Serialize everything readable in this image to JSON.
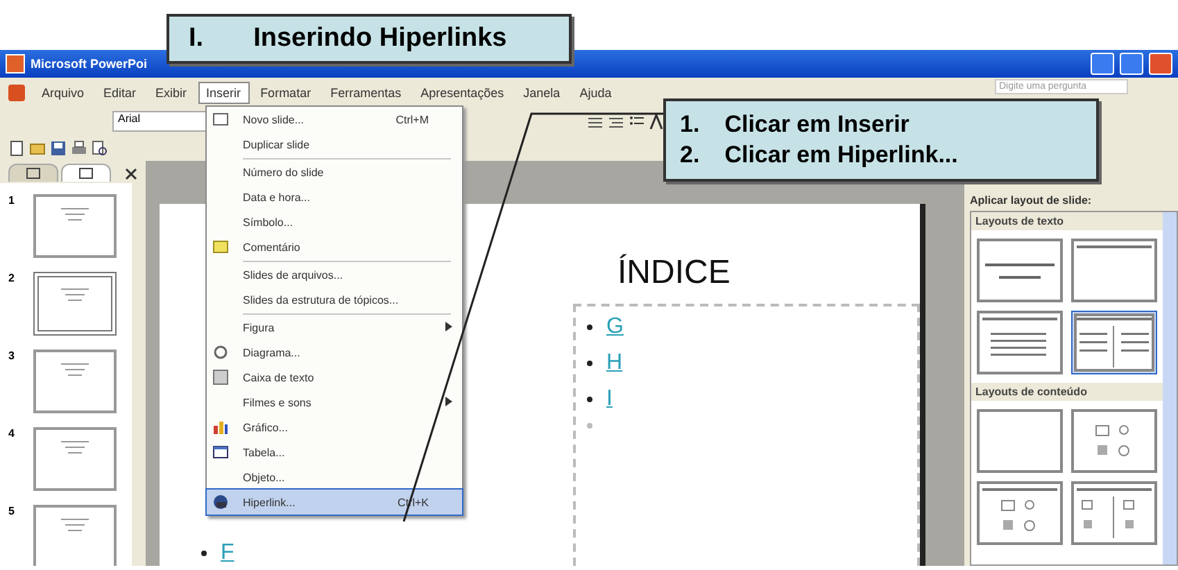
{
  "title_callout": {
    "number": "I.",
    "text": "Inserindo Hiperlinks"
  },
  "steps_callout": {
    "steps": [
      {
        "number": "1.",
        "text": "Clicar em Inserir"
      },
      {
        "number": "2.",
        "text": "Clicar em Hiperlink..."
      }
    ]
  },
  "window": {
    "title": "Microsoft PowerPoi"
  },
  "menu_bar": {
    "items": [
      {
        "label": "Arquivo",
        "selected": false
      },
      {
        "label": "Editar",
        "selected": false
      },
      {
        "label": "Exibir",
        "selected": false
      },
      {
        "label": "Inserir",
        "selected": true
      },
      {
        "label": "Formatar",
        "selected": false
      },
      {
        "label": "Ferramentas",
        "selected": false
      },
      {
        "label": "Apresentações",
        "selected": false
      },
      {
        "label": "Janela",
        "selected": false
      },
      {
        "label": "Ajuda",
        "selected": false
      }
    ],
    "search": {
      "placeholder": "Digite uma pergunta"
    }
  },
  "toolbar": {
    "font": "Arial"
  },
  "pane_tabs": [
    {
      "selected": false
    },
    {
      "selected": true
    }
  ],
  "slides": [
    {
      "number": "1",
      "selected": false
    },
    {
      "number": "2",
      "selected": true
    },
    {
      "number": "3",
      "selected": false
    },
    {
      "number": "4",
      "selected": false
    },
    {
      "number": "5",
      "selected": false
    }
  ],
  "slide": {
    "title": "ÍNDICE",
    "left_bullets": [
      "F"
    ],
    "bullets": [
      "G",
      "H",
      "I"
    ]
  },
  "insert_menu": [
    {
      "label": "Novo slide...",
      "shortcut": "Ctrl+M",
      "separator_before": false,
      "submenu": false,
      "selected": false
    },
    {
      "label": "Duplicar slide",
      "separator_before": false,
      "submenu": false,
      "selected": false
    },
    {
      "label": "Número do slide",
      "separator_before": true,
      "submenu": false,
      "selected": false
    },
    {
      "label": "Data e hora...",
      "separator_before": false,
      "submenu": false,
      "selected": false
    },
    {
      "label": "Símbolo...",
      "separator_before": false,
      "submenu": false,
      "selected": false
    },
    {
      "label": "Comentário",
      "separator_before": false,
      "submenu": false,
      "selected": false
    },
    {
      "label": "Slides de arquivos...",
      "separator_before": true,
      "submenu": false,
      "selected": false
    },
    {
      "label": "Slides da estrutura de tópicos...",
      "separator_before": false,
      "submenu": false,
      "selected": false
    },
    {
      "label": "Figura",
      "separator_before": true,
      "submenu": true,
      "selected": false
    },
    {
      "label": "Diagrama...",
      "separator_before": false,
      "submenu": false,
      "selected": false
    },
    {
      "label": "Caixa de texto",
      "separator_before": false,
      "submenu": false,
      "selected": false
    },
    {
      "label": "Filmes e sons",
      "separator_before": false,
      "submenu": true,
      "selected": false
    },
    {
      "label": "Gráfico...",
      "separator_before": false,
      "submenu": false,
      "selected": false
    },
    {
      "label": "Tabela...",
      "separator_before": false,
      "submenu": false,
      "selected": false
    },
    {
      "label": "Objeto...",
      "separator_before": false,
      "submenu": false,
      "selected": false
    },
    {
      "label": "Hiperlink...",
      "shortcut": "Ctrl+K",
      "separator_before": false,
      "submenu": false,
      "selected": true
    }
  ],
  "task_pane": {
    "title": "Aplicar layout de slide:",
    "sections": [
      {
        "title": "Layouts de texto",
        "layouts": [
          {
            "kind": "title",
            "selected": false
          },
          {
            "kind": "title-only",
            "selected": false
          },
          {
            "kind": "bullets",
            "selected": false
          },
          {
            "kind": "two-columns",
            "selected": true
          }
        ]
      },
      {
        "title": "Layouts de conteúdo",
        "layouts": [
          {
            "kind": "blank",
            "selected": false
          },
          {
            "kind": "content",
            "selected": false
          },
          {
            "kind": "title-content",
            "selected": false
          },
          {
            "kind": "title-two-content",
            "selected": false
          }
        ]
      }
    ]
  }
}
